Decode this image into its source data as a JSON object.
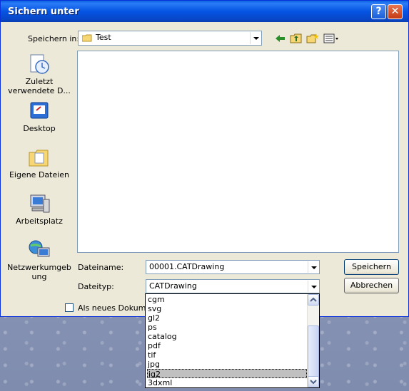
{
  "window": {
    "title": "Sichern unter",
    "help": "?",
    "close": "✕"
  },
  "save_in": {
    "label": "Speichern in:",
    "value": "Test"
  },
  "places": [
    {
      "label": "Zuletzt verwendete D...",
      "icon": "recent-documents-icon"
    },
    {
      "label": "Desktop",
      "icon": "desktop-icon"
    },
    {
      "label": "Eigene Dateien",
      "icon": "my-documents-icon"
    },
    {
      "label": "Arbeitsplatz",
      "icon": "my-computer-icon"
    },
    {
      "label": "Netzwerkumgebung",
      "icon": "network-places-icon"
    }
  ],
  "filename": {
    "label": "Dateiname:",
    "value": "00001.CATDrawing"
  },
  "filetype": {
    "label": "Dateityp:",
    "value": "CATDrawing",
    "options": [
      "cgm",
      "svg",
      "gl2",
      "ps",
      "catalog",
      "pdf",
      "tif",
      "jpg",
      "ig2",
      "3dxml"
    ],
    "highlighted": "ig2"
  },
  "buttons": {
    "save": "Speichern",
    "cancel": "Abbrechen"
  },
  "checkbox": {
    "label": "Als neues Dokumen",
    "checked": false
  }
}
